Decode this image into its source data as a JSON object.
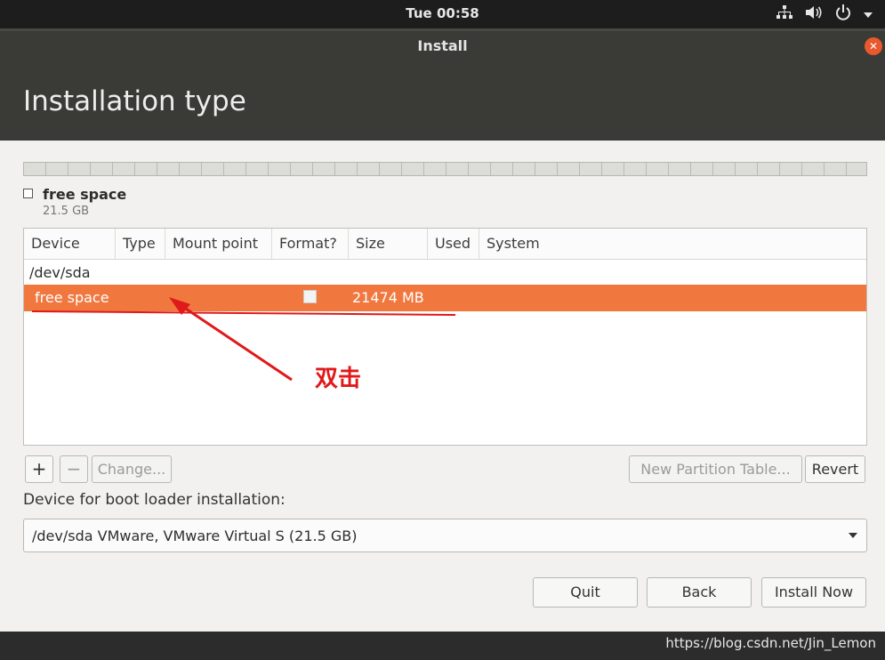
{
  "topbar": {
    "clock": "Tue 00:58",
    "icons": [
      "network-icon",
      "volume-icon",
      "power-icon",
      "chevron-down-icon"
    ]
  },
  "window": {
    "title": "Install",
    "page_title": "Installation type"
  },
  "partition_bar": {
    "legend_name": "free space",
    "legend_size": "21.5 GB"
  },
  "table": {
    "columns": [
      "Device",
      "Type",
      "Mount point",
      "Format?",
      "Size",
      "Used",
      "System"
    ],
    "device": "/dev/sda",
    "selected_row": {
      "device": "free space",
      "format_checked": false,
      "size": "21474 MB"
    },
    "selected_color": "#f0783f"
  },
  "toolbar": {
    "add_label": "+",
    "remove_label": "−",
    "change_label": "Change...",
    "new_table_label": "New Partition Table...",
    "revert_label": "Revert"
  },
  "boot_loader": {
    "label": "Device for boot loader installation:",
    "selected": "/dev/sda VMware, VMware Virtual S (21.5 GB)"
  },
  "footer": {
    "quit_label": "Quit",
    "back_label": "Back",
    "install_label": "Install Now"
  },
  "annotation": {
    "text": "双击",
    "color": "#e0191b"
  },
  "watermark": "https://blog.csdn.net/Jin_Lemon"
}
